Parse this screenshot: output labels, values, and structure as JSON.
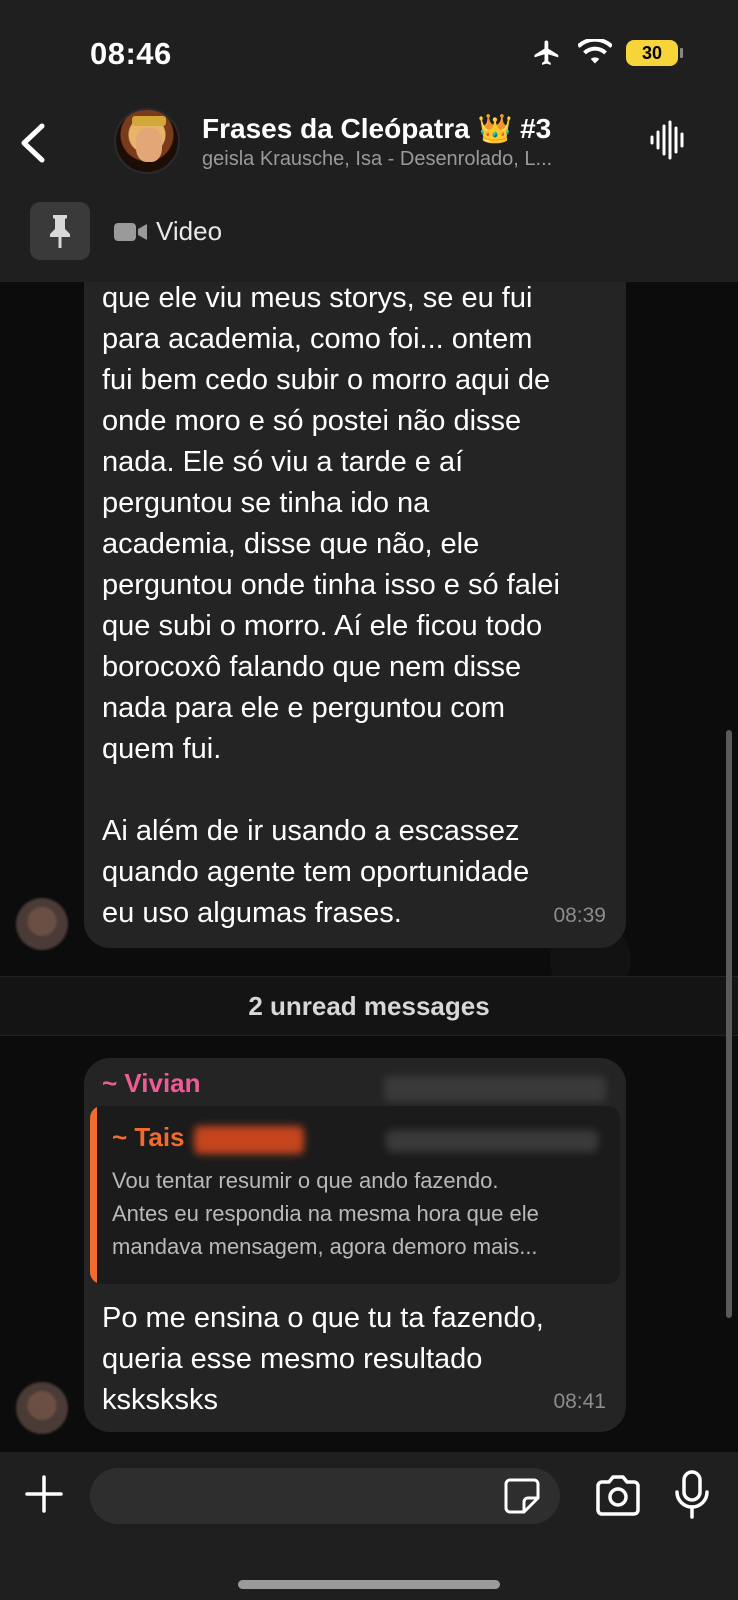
{
  "status_bar": {
    "time": "08:46",
    "battery": "30"
  },
  "header": {
    "title": "Frases da Cleópatra 👑 #3",
    "subtitle": "geisla Krausche, Isa - Desenrolado, L...",
    "pinned_label": "Video"
  },
  "messages": [
    {
      "text": "que ele viu meus storys, se eu fui\npara academia, como foi... ontem\nfui bem cedo subir o morro aqui de\nonde moro e só postei não disse\nnada. Ele só viu a tarde e aí\nperguntou se tinha ido na\nacademia, disse que não, ele\nperguntou onde tinha isso e só falei\nque subi o morro. Aí ele ficou todo\nborocoxô falando que nem disse\nnada para ele e perguntou com\nquem fui.\n\nAi além de ir usando a escassez\nquando agente tem oportunidade\neu uso algumas frases.",
      "time": "08:39"
    },
    {
      "sender": "~ Vivian",
      "quote_sender": "~ Tais",
      "quote_text": "Vou tentar resumir o que ando fazendo.\nAntes eu respondia na mesma hora que ele\nmandava mensagem, agora demoro mais...",
      "text": "Po me ensina o que tu ta fazendo,\nqueria esse mesmo resultado\nksksksks",
      "time": "08:41"
    }
  ],
  "unread_label": "2 unread messages",
  "input": {
    "placeholder": ""
  },
  "colors": {
    "background": "#0c0c0c",
    "bubble": "#242424",
    "header": "#1f1f1f",
    "sender_name": "#ee5c98",
    "quote_accent": "#f26b2e",
    "battery": "#f7d43a"
  }
}
